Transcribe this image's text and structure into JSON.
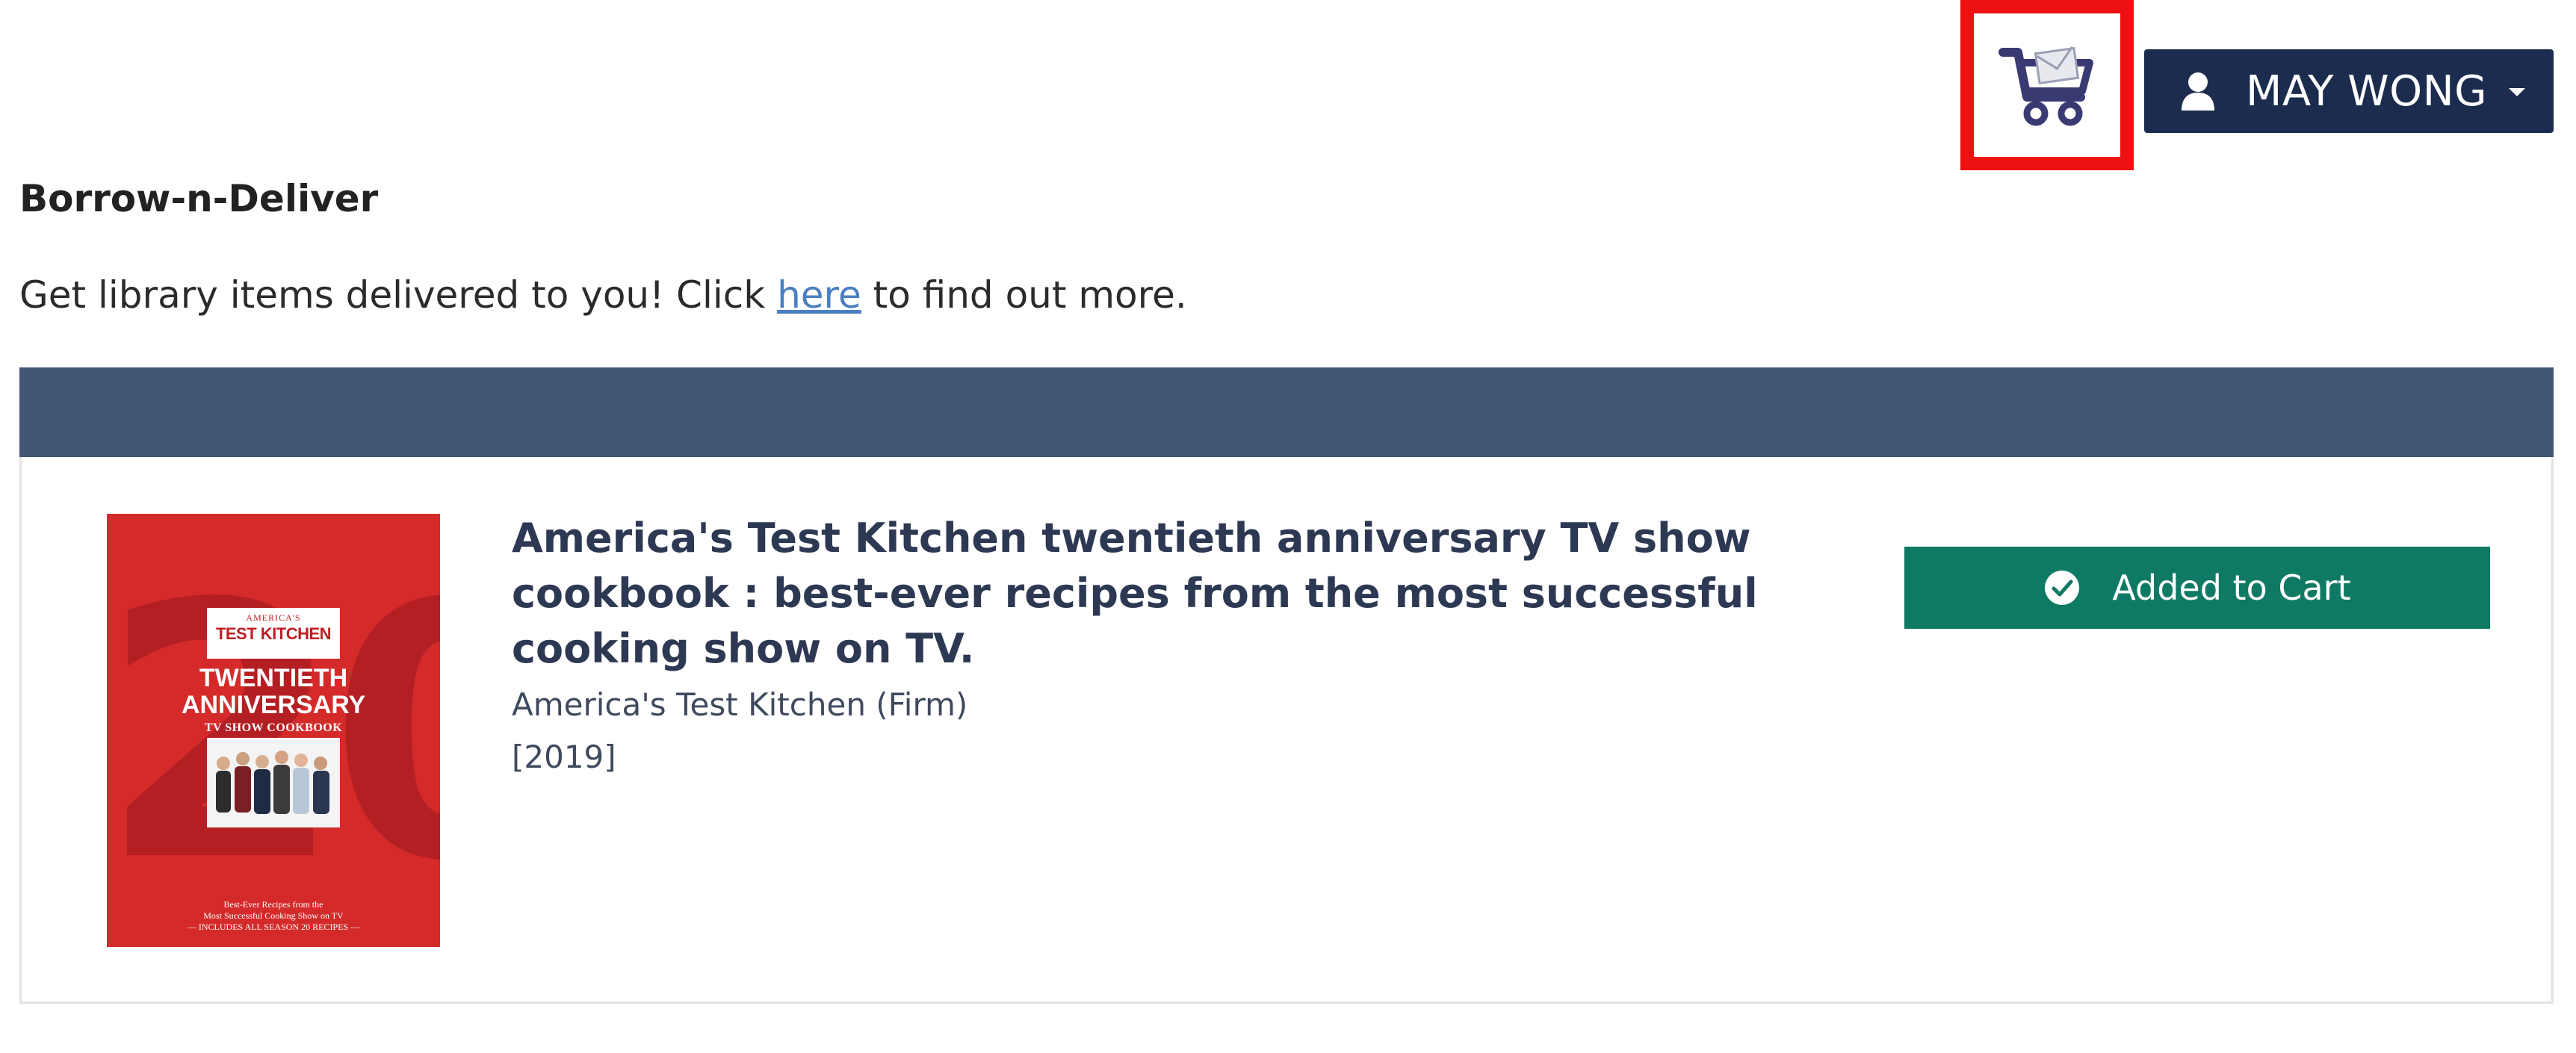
{
  "header": {
    "cart_icon": "cart-icon",
    "user": {
      "icon": "person-icon",
      "name": "MAY WONG",
      "dropdown_icon": "caret-down-icon"
    }
  },
  "section": {
    "title": "Borrow-n-Deliver",
    "intro_before": "Get library items delivered to you! Click ",
    "intro_link": "here",
    "intro_after": " to find out more."
  },
  "result": {
    "cover": {
      "brand_small": "AMERICA'S",
      "brand_big": "TEST KITCHEN",
      "edition_line1": "TWENTIETH",
      "edition_line2": "ANNIVERSARY",
      "subtitle": "TV SHOW COOKBOOK",
      "big_number": "20",
      "tagline_line1": "Best-Ever Recipes from the",
      "tagline_line2": "Most Successful Cooking Show on TV",
      "tagline_line3": "— INCLUDES ALL SEASON 20 RECIPES —"
    },
    "title": "America's Test Kitchen twentieth anniversary TV show cookbook : best-ever recipes from the most successful cooking show on TV.",
    "author": "America's Test Kitchen (Firm)",
    "year": "[2019]",
    "action": {
      "icon": "check-circle-icon",
      "label": "Added to Cart"
    }
  },
  "colors": {
    "highlight_border": "#ee1111",
    "cart_icon": "#3a3a73",
    "user_button": "#1c2c4f",
    "results_bar": "#425675",
    "added_button": "#0f7a64",
    "link": "#4a7fc1",
    "title_text": "#2d3853"
  }
}
